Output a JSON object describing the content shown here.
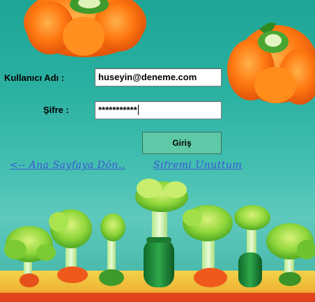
{
  "form": {
    "username_label": "Kullanıcı Adı :",
    "username_value": "huseyin@deneme.com",
    "password_label": "Şifre :",
    "password_value": "***********",
    "login_label": "Giriş"
  },
  "links": {
    "back_home": "<-- Ana Sayfaya Dön..",
    "forgot_password": "Şifremi Unuttum"
  },
  "colors": {
    "link": "#3b55d6",
    "button_bg": "#5fc8a6",
    "background": "#2bb1a1"
  }
}
